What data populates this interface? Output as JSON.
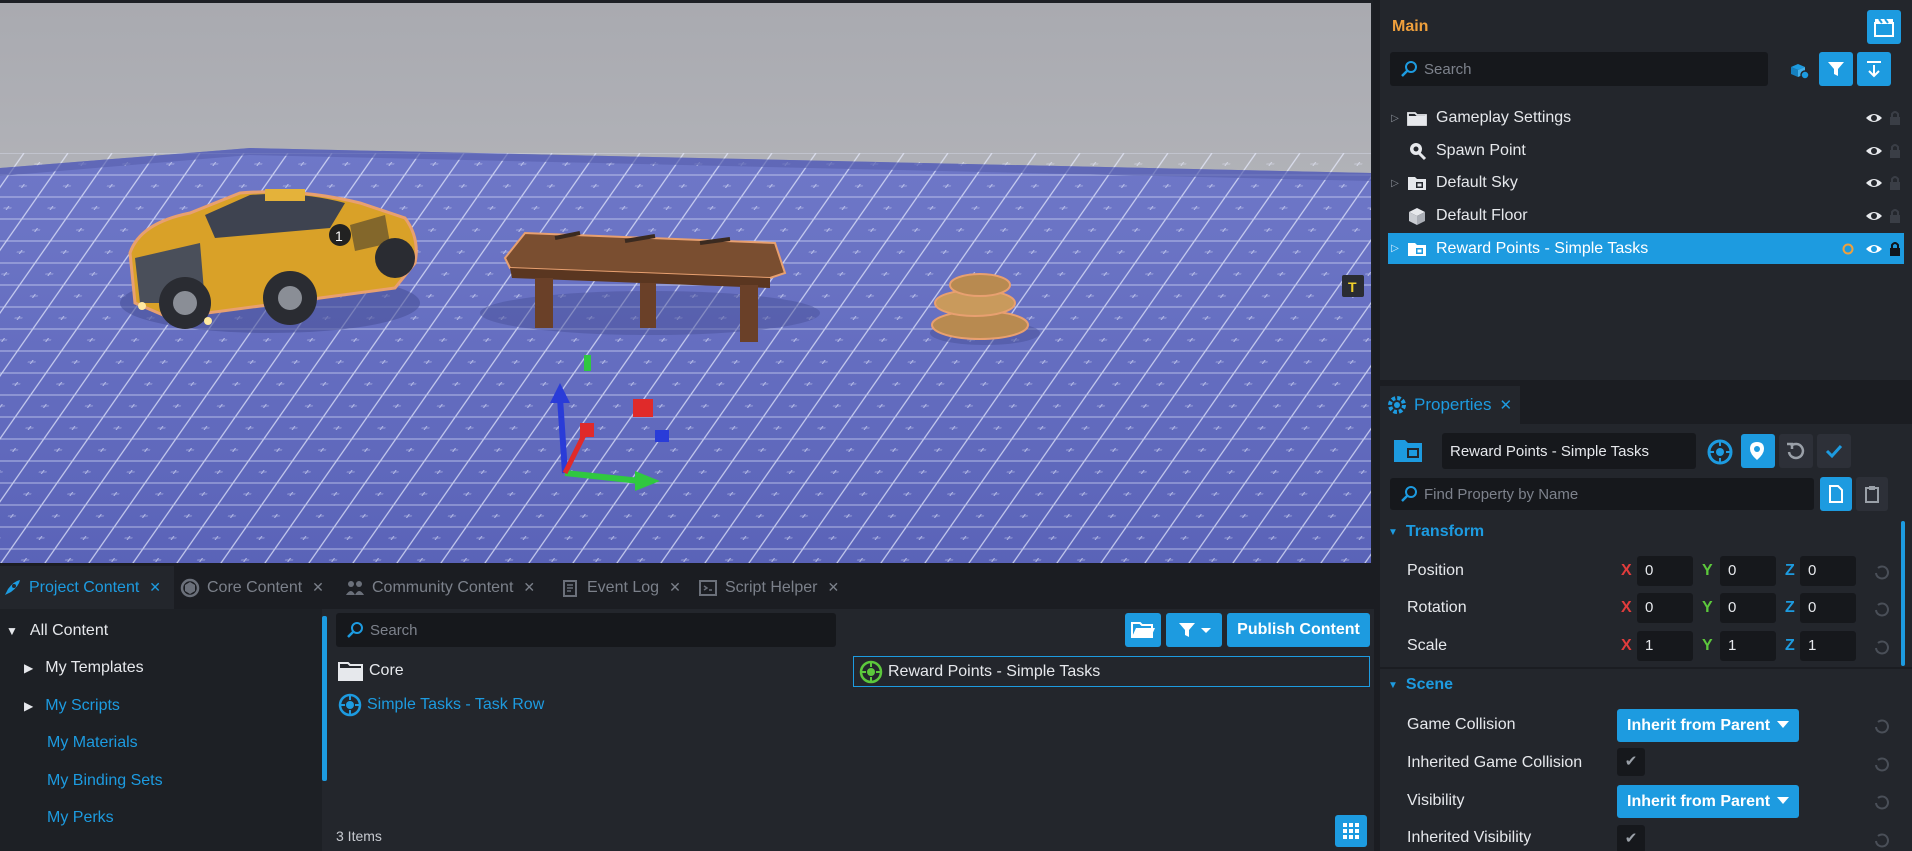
{
  "hierarchy": {
    "title": "Main",
    "search_placeholder": "Search",
    "items": [
      {
        "label": "Gameplay Settings",
        "icon": "folder-icon",
        "expandable": true
      },
      {
        "label": "Spawn Point",
        "icon": "spawn-point-icon",
        "expandable": false
      },
      {
        "label": "Default Sky",
        "icon": "template-icon",
        "expandable": true
      },
      {
        "label": "Default Floor",
        "icon": "cube-icon",
        "expandable": false
      },
      {
        "label": "Reward Points - Simple Tasks",
        "icon": "template-icon",
        "expandable": true,
        "selected": true
      }
    ]
  },
  "properties": {
    "tab_label": "Properties",
    "object_name": "Reward Points - Simple Tasks",
    "find_placeholder": "Find Property by Name",
    "transform": {
      "header": "Transform",
      "rows": [
        {
          "label": "Position",
          "x": "0",
          "y": "0",
          "z": "0"
        },
        {
          "label": "Rotation",
          "x": "0",
          "y": "0",
          "z": "0"
        },
        {
          "label": "Scale",
          "x": "1",
          "y": "1",
          "z": "1"
        }
      ],
      "axis_labels": {
        "x": "X",
        "y": "Y",
        "z": "Z"
      }
    },
    "scene": {
      "header": "Scene",
      "game_collision_label": "Game Collision",
      "game_collision_value": "Inherit from Parent",
      "inherited_game_collision_label": "Inherited Game Collision",
      "visibility_label": "Visibility",
      "visibility_value": "Inherit from Parent",
      "inherited_visibility_label": "Inherited Visibility"
    }
  },
  "bottom": {
    "tabs": [
      {
        "label": "Project Content",
        "active": true
      },
      {
        "label": "Core Content",
        "active": false
      },
      {
        "label": "Community Content",
        "active": false
      },
      {
        "label": "Event Log",
        "active": false
      },
      {
        "label": "Script Helper",
        "active": false
      }
    ],
    "tree": [
      {
        "label": "All Content",
        "expanded": true
      },
      {
        "label": "My Templates",
        "expandable": true
      },
      {
        "label": "My Scripts",
        "expandable": true
      },
      {
        "label": "My Materials"
      },
      {
        "label": "My Binding Sets"
      },
      {
        "label": "My Perks"
      }
    ],
    "search_placeholder": "Search",
    "publish_label": "Publish Content",
    "files": [
      {
        "label": "Core",
        "icon": "folder-icon"
      },
      {
        "label": "Simple Tasks - Task Row",
        "icon": "template-icon"
      },
      {
        "label": "Reward Points - Simple Tasks",
        "icon": "template-icon"
      }
    ],
    "item_count": "3 Items"
  },
  "colors": {
    "accent": "#1d9be0",
    "title_orange": "#f0a03c",
    "axis_x": "#e03c3c",
    "axis_y": "#5cc83c",
    "axis_z": "#1d9be0"
  }
}
